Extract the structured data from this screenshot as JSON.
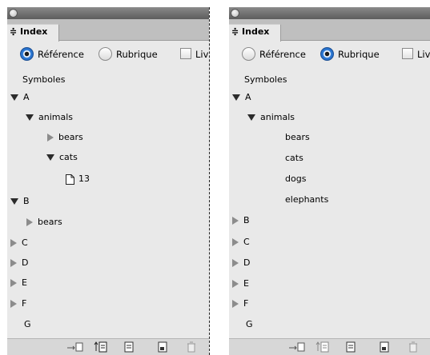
{
  "panels": [
    {
      "tab_label": "≑ Index",
      "radio": {
        "reference_label": "Référence",
        "topic_label": "Rubrique",
        "book_label": "Liv",
        "selected": "reference"
      },
      "symbols_label": "Symboles",
      "letter_a": "A",
      "animals": "animals",
      "bears": "bears",
      "cats": "cats",
      "page_number": "13",
      "letter_b": "B",
      "b_bears": "bears",
      "letter_c": "C",
      "letter_d": "D",
      "letter_e": "E",
      "letter_f": "F",
      "letter_g": "G"
    },
    {
      "tab_label": "≑ Index",
      "radio": {
        "reference_label": "Référence",
        "topic_label": "Rubrique",
        "book_label": "Liv",
        "selected": "topic"
      },
      "symbols_label": "Symboles",
      "letter_a": "A",
      "animals": "animals",
      "bears": "bears",
      "cats": "cats",
      "dogs": "dogs",
      "elephants": "elephants",
      "letter_b": "B",
      "letter_c": "C",
      "letter_d": "D",
      "letter_e": "E",
      "letter_f": "F",
      "letter_g": "G"
    }
  ],
  "icons": [
    "go-to-entry-icon",
    "update-preview-icon",
    "generate-index-icon",
    "new-entry-icon",
    "delete-icon"
  ]
}
